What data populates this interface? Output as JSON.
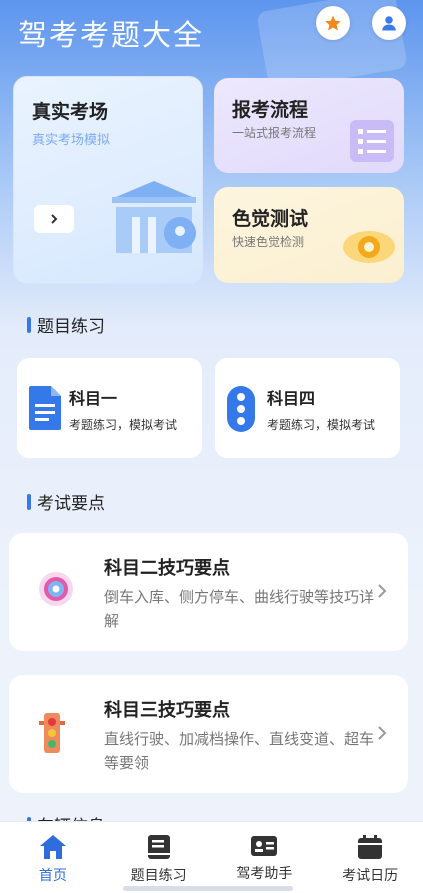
{
  "header": {
    "title": "驾考考题大全"
  },
  "cards": {
    "real_exam": {
      "title": "真实考场",
      "subtitle": "真实考场模拟"
    },
    "process": {
      "title": "报考流程",
      "subtitle": "一站式报考流程"
    },
    "color_test": {
      "title": "色觉测试",
      "subtitle": "快速色觉检测"
    }
  },
  "sections": {
    "practice": "题目练习",
    "key_points": "考试要点",
    "next_partial": "车辆信息"
  },
  "subjects": [
    {
      "name": "科目一",
      "desc": "考题练习，模拟考试"
    },
    {
      "name": "科目四",
      "desc": "考题练习，模拟考试"
    }
  ],
  "tips": [
    {
      "title": "科目二技巧要点",
      "desc": "倒车入库、侧方停车、曲线行驶等技巧详解"
    },
    {
      "title": "科目三技巧要点",
      "desc": "直线行驶、加减档操作、直线变道、超车等要领"
    }
  ],
  "tabs": [
    {
      "label": "首页",
      "active": true
    },
    {
      "label": "题目练习",
      "active": false
    },
    {
      "label": "驾考助手",
      "active": false
    },
    {
      "label": "考试日历",
      "active": false
    }
  ],
  "colors": {
    "accent": "#2f6ddd",
    "star": "#f08a1c"
  }
}
